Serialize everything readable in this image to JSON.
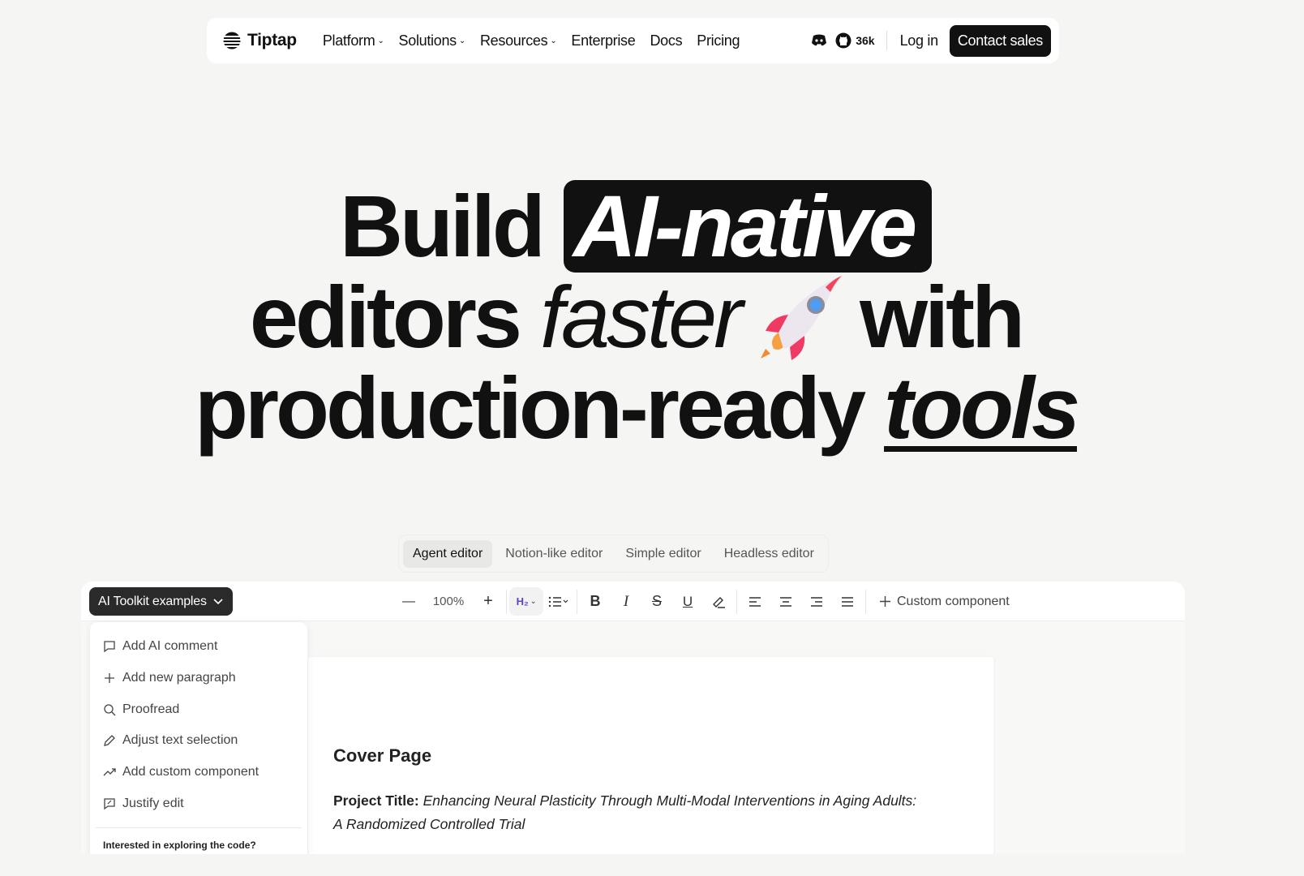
{
  "nav": {
    "logo": "Tiptap",
    "links": [
      "Platform",
      "Solutions",
      "Resources",
      "Enterprise",
      "Docs",
      "Pricing"
    ],
    "github_stars": "36k",
    "login": "Log in",
    "cta": "Contact sales"
  },
  "hero": {
    "w1": "Build",
    "pill": "AI-native",
    "w2": "editors",
    "w3": "faster",
    "w4": "with",
    "w5": "production-ready",
    "w6": "tools"
  },
  "tabs": [
    "Agent editor",
    "Notion-like editor",
    "Simple editor",
    "Headless editor"
  ],
  "editor": {
    "ai_button": "AI Toolkit examples",
    "zoom": "100%",
    "heading_button": "H₂",
    "custom_component": "Custom component",
    "menu": [
      "Add AI comment",
      "Add new paragraph",
      "Proofread",
      "Adjust text selection",
      "Add custom component",
      "Justify edit"
    ],
    "menu_note": "Interested in exploring the code?",
    "doc_heading": "Cover Page",
    "doc_label": "Project Title:",
    "doc_title": "Enhancing Neural Plasticity Through Multi-Modal Interventions in Aging Adults: A Randomized Controlled Trial"
  },
  "colors": {
    "page_bg": "#f5f5f4",
    "accent_text": "#5b3fd6",
    "dark": "#111111"
  }
}
